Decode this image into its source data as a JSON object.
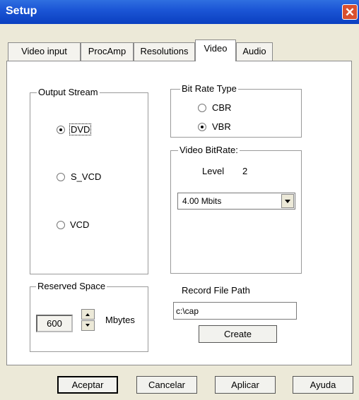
{
  "window": {
    "title": "Setup"
  },
  "tabs": [
    "Video input",
    "ProcAmp",
    "Resolutions",
    "Video",
    "Audio"
  ],
  "active_tab": "Video",
  "output_stream": {
    "legend": "Output Stream",
    "options": [
      "DVD",
      "S_VCD",
      "VCD"
    ],
    "selected": "DVD"
  },
  "bit_rate_type": {
    "legend": "Bit Rate Type",
    "options": [
      "CBR",
      "VBR"
    ],
    "selected": "VBR"
  },
  "video_bitrate": {
    "legend": "Video BitRate:",
    "level_label": "Level",
    "level_value": "2",
    "selected": "4.00 Mbits"
  },
  "reserved_space": {
    "legend": "Reserved Space",
    "value": "600",
    "unit": "Mbytes"
  },
  "record_file_path": {
    "label": "Record File Path",
    "value": "c:\\cap",
    "create_label": "Create"
  },
  "buttons": {
    "accept": "Aceptar",
    "cancel": "Cancelar",
    "apply": "Aplicar",
    "help": "Ayuda"
  }
}
